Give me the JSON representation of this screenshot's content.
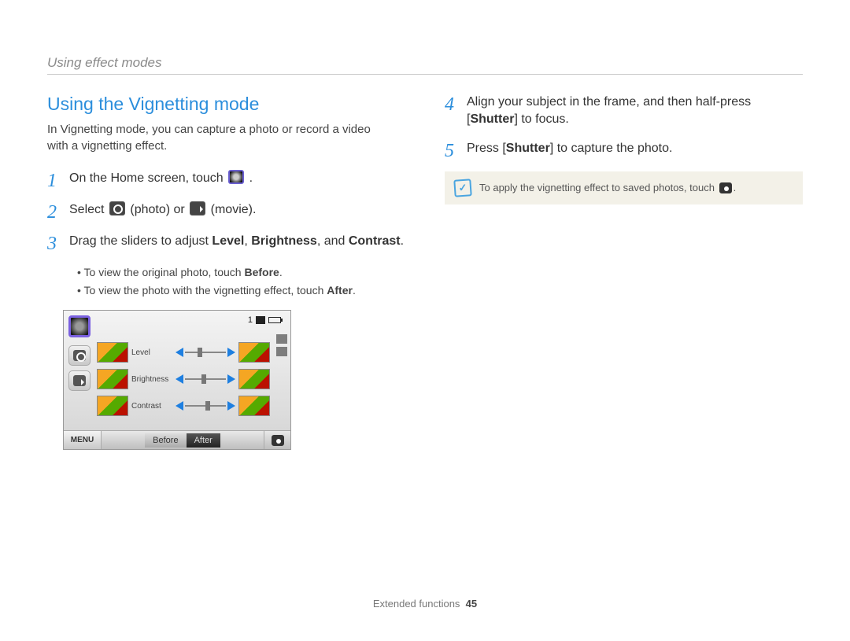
{
  "header": {
    "breadcrumb": "Using effect modes"
  },
  "section": {
    "title": "Using the Vignetting mode",
    "intro": "In Vignetting mode, you can capture a photo or record a video with a vignetting effect."
  },
  "steps": {
    "s1_pre": "On the Home screen, touch ",
    "s1_post": ".",
    "s2_pre": "Select ",
    "s2_mid": " (photo) or ",
    "s2_post": " (movie).",
    "s3a": "Drag the sliders to adjust ",
    "s3b": "Level",
    "s3c": ", ",
    "s3d": "Brightness",
    "s3e": ", and ",
    "s3f": "Contrast",
    "s3g": ".",
    "sub1a": "To view the original photo, touch ",
    "sub1b": "Before",
    "sub1c": ".",
    "sub2a": "To view the photo with the vignetting effect, touch ",
    "sub2b": "After",
    "sub2c": ".",
    "s4a": "Align your subject in the frame, and then half-press [",
    "s4b": "Shutter",
    "s4c": "] to focus.",
    "s5a": "Press [",
    "s5b": "Shutter",
    "s5c": "] to capture the photo."
  },
  "note": {
    "text_pre": "To apply the vignetting effect to saved photos, touch ",
    "text_post": "."
  },
  "screen": {
    "counter": "1",
    "sliders": {
      "level": "Level",
      "brightness": "Brightness",
      "contrast": "Contrast"
    },
    "menu": "MENU",
    "before": "Before",
    "after": "After"
  },
  "footer": {
    "label": "Extended functions",
    "page": "45"
  }
}
